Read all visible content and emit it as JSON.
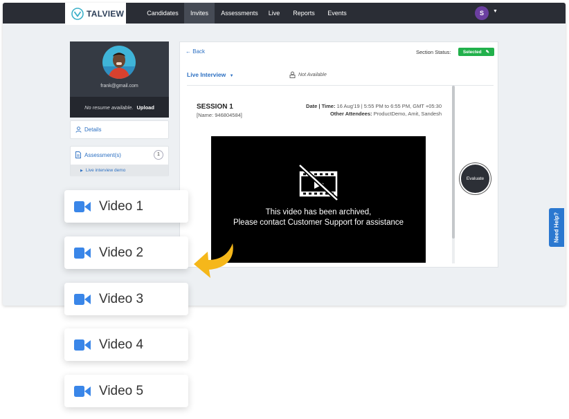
{
  "nav": {
    "logo_text": "TALVIEW",
    "items": [
      {
        "label": "Candidates"
      },
      {
        "label": "Invites"
      },
      {
        "label": "Assessments"
      },
      {
        "label": "Live"
      },
      {
        "label": "Reports"
      },
      {
        "label": "Events"
      }
    ],
    "active_item": "Invites",
    "user_initial": "S"
  },
  "profile": {
    "email": "frank@gmail.com",
    "resume_status": "No resume available.",
    "upload_label": "Upload"
  },
  "sidebar": {
    "details_label": "Details",
    "assessments_label": "Assessment(s)",
    "assessments_count": "1",
    "assessment_item": "Live interview demo"
  },
  "panel": {
    "back_label": "Back",
    "section_status_label": "Section Status:",
    "section_status_value": "Selected",
    "interview_type": "Live Interview",
    "availability": "Not Available",
    "session": {
      "title": "SESSION 1",
      "name": "[Name: 946804584]",
      "date_label": "Date | Time:",
      "date_value": "16 Aug'19 | 5:55 PM to 6:55 PM, GMT +05:30",
      "attendees_label": "Other Attendees:",
      "attendees_value": "ProductDemo, Amit, Sandesh"
    },
    "video_message_line1": "This video has been archived,",
    "video_message_line2": "Please contact Customer Support for assistance",
    "evaluate_label": "Evaluate"
  },
  "help_tab": "Need Help?",
  "video_cards": [
    {
      "label": "Video 1"
    },
    {
      "label": "Video 2"
    },
    {
      "label": "Video 3"
    },
    {
      "label": "Video 4"
    },
    {
      "label": "Video 5"
    }
  ],
  "colors": {
    "nav_bg": "#2a2d35",
    "accent_blue": "#2b6fc2",
    "status_green": "#21b04b",
    "camera_icon_blue": "#3a86e8",
    "arrow_yellow": "#f5b71a",
    "avatar_purple": "#6b3fa0"
  }
}
